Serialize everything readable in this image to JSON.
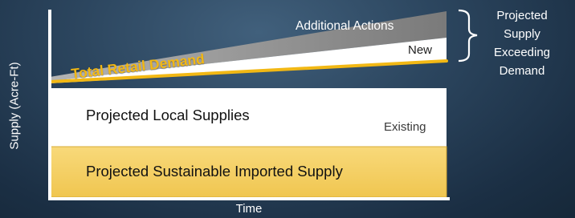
{
  "axes": {
    "y_label": "Supply (Acre-Ft)",
    "x_label": "Time"
  },
  "bands": {
    "imported": {
      "label": "Projected Sustainable Imported Supply",
      "color": "#f6d36c"
    },
    "local": {
      "label": "Projected Local Supplies",
      "tag": "Existing",
      "color": "#ffffff"
    },
    "new_supply": {
      "tag": "New",
      "color": "#ffffff"
    },
    "additional": {
      "label": "Additional Actions",
      "color": "#8c8c8c"
    }
  },
  "demand_line": {
    "label": "Total Retail Demand",
    "color": "#f2b814"
  },
  "bracket_note": {
    "lines": [
      "Projected",
      "Supply",
      "Exceeding",
      "Demand"
    ]
  },
  "colors": {
    "background": "#2c465f",
    "axis": "#ffffff"
  }
}
